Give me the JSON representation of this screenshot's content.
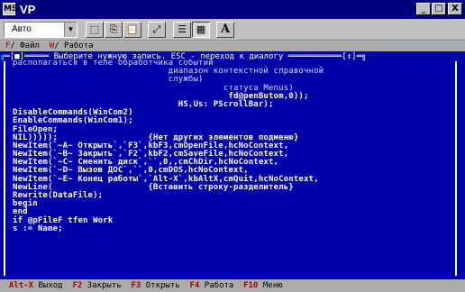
{
  "window": {
    "title": "VP",
    "icon_label": "MS",
    "minimize_glyph": "_",
    "maximize_glyph": "□",
    "close_glyph": "X"
  },
  "toolbar": {
    "font_select_value": "Авто",
    "font_select_arrow": "▼",
    "buttons": [
      {
        "icon": "mark-icon",
        "glyph": "⬚"
      },
      {
        "icon": "copy-icon",
        "glyph": "⎘"
      },
      {
        "icon": "paste-icon",
        "glyph": "📋"
      },
      {
        "icon": "fullscreen-icon",
        "glyph": "⤢"
      },
      {
        "icon": "properties-icon",
        "glyph": "☰"
      },
      {
        "icon": "background-icon",
        "glyph": "▦"
      },
      {
        "icon": "font-icon",
        "glyph": "A"
      }
    ]
  },
  "menubar": {
    "items": [
      {
        "hot": "F",
        "rest": "/ Файл"
      },
      {
        "hot": "W",
        "rest": "/ Работа"
      }
    ]
  },
  "dialog": {
    "left_marker": "═[■]═════",
    "title": " Выберите нужную запись. ESC - переход к диалогу ",
    "right_marker": "═══════════[↕]═",
    "corner_left": "╔",
    "corner_right": "╗"
  },
  "code_lines": [
    "располагаться в теле обработчика событий",
    "                               диапазон контекстной справочной",
    "                               службы)",
    "                                          статуса Menus)",
    "                                           fd@penButom,0));",
    "                                 HS,Us: PScrollBar);",
    "DisableCommands(WinCom2)",
    "EnableCommands(WinCom1);",
    "FileOpen;",
    "NIL)))));                  {Нет других элементов подменю}",
    "NewItem(`~A~ Открыть`,`F3`,kbF3,cmOpenFile,hcNoContext,",
    "NewItem(`~B~ Закрыть`,`F2`,kbF2,cmSaveFile,hcNoContext,",
    "NewItem(`~C~ Сменить диск`,``,0,,cmChDir,hcNoContext,",
    "NewItem(`~D~ Вызов ДОС`,``,0,cmDOS,hcNoContext,",
    "NewItem(`~E~ Конец работы`,`Alt-X`,kbAltX,cmQuit,hcNoContext,",
    "NewLine(                   {Вставить строку-разделитель}",
    "Rewrite(DataFile);",
    "begin",
    "end",
    "if @pFileF tfen Work",
    "s := Name;"
  ],
  "statusbar": {
    "items": [
      {
        "key": "Alt-X",
        "label": " Выход"
      },
      {
        "key": "F2",
        "label": " Закрыть"
      },
      {
        "key": "F3",
        "label": " Открыть"
      },
      {
        "key": "F4",
        "label": " Работа"
      },
      {
        "key": "F10",
        "label": " Меню"
      }
    ]
  },
  "colors": {
    "console_bg": "#0000a8",
    "titlebar_bg": "#000080",
    "menu_bg": "#aaaaaa",
    "hotkey": "#a80000"
  }
}
